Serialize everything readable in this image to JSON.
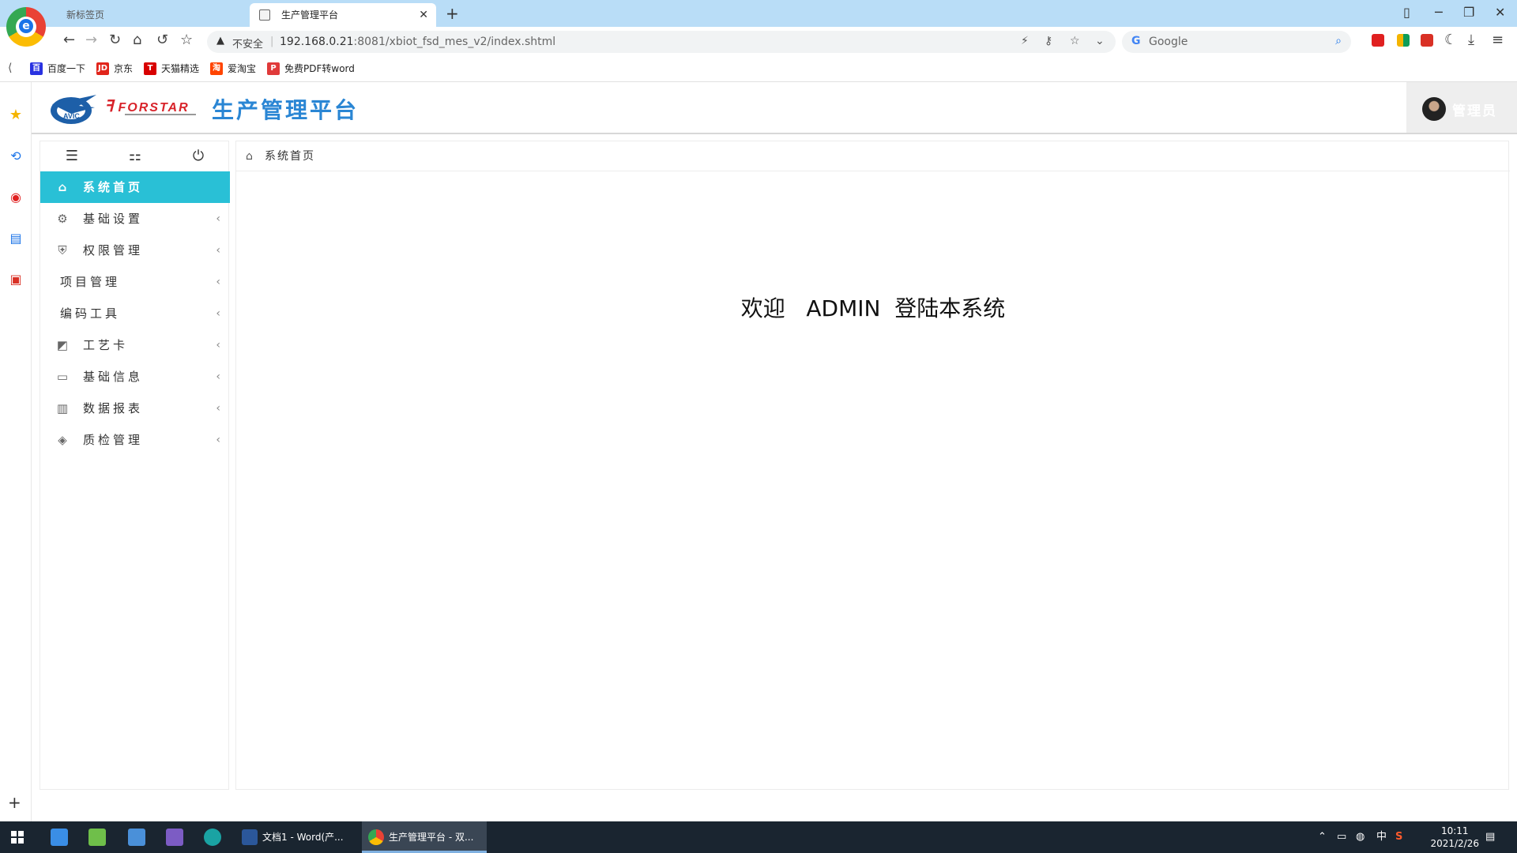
{
  "browser": {
    "tabs": [
      {
        "title": "新标签页",
        "active": false
      },
      {
        "title": "生产管理平台",
        "active": true
      }
    ],
    "address": {
      "security_label": "不安全",
      "url_host": "192.168.0.21",
      "url_rest": ":8081/xbiot_fsd_mes_v2/index.shtml"
    },
    "search": {
      "placeholder": "Google"
    },
    "bookmarks": [
      {
        "label": "百度一下",
        "icon": "baidu-icon",
        "color": "#2932e1"
      },
      {
        "label": "京东",
        "icon": "jd-icon",
        "color": "#e1251b"
      },
      {
        "label": "天猫精选",
        "icon": "tmall-icon",
        "color": "#d80000"
      },
      {
        "label": "爱淘宝",
        "icon": "aitaobao-icon",
        "color": "#ff4400"
      },
      {
        "label": "免费PDF转word",
        "icon": "pdf-icon",
        "color": "#e03a3a"
      }
    ]
  },
  "app": {
    "brand": "FORSTAR",
    "logo_text": "AVIC",
    "title": "生产管理平台",
    "user": "管理员",
    "accent_color": "#29c0d6",
    "title_color": "#2a86d4",
    "sidebar_tools": [
      "menu-toggle-icon",
      "book-icon",
      "power-icon"
    ],
    "menu": [
      {
        "label": "系统首页",
        "icon": "home-icon",
        "active": true,
        "arrow": false
      },
      {
        "label": "基础设置",
        "icon": "gear-icon",
        "active": false,
        "arrow": true
      },
      {
        "label": "权限管理",
        "icon": "shield-icon",
        "active": false,
        "arrow": true
      },
      {
        "label": "项目管理",
        "icon": "",
        "active": false,
        "arrow": true
      },
      {
        "label": "编码工具",
        "icon": "",
        "active": false,
        "arrow": true
      },
      {
        "label": "工艺卡",
        "icon": "card-icon",
        "active": false,
        "arrow": true
      },
      {
        "label": "基础信息",
        "icon": "monitor-icon",
        "active": false,
        "arrow": true
      },
      {
        "label": "数据报表",
        "icon": "table-icon",
        "active": false,
        "arrow": true
      },
      {
        "label": "质检管理",
        "icon": "layers-icon",
        "active": false,
        "arrow": true
      }
    ],
    "breadcrumb": "系统首页",
    "welcome": "欢迎   ADMIN  登陆本系统"
  },
  "taskbar": {
    "apps": [
      {
        "label": "文档1 - Word(产...",
        "icon": "word-icon",
        "active": false
      },
      {
        "label": "生产管理平台 - 双...",
        "icon": "browser-icon",
        "active": true
      }
    ],
    "ime": "中",
    "time": "10:11",
    "date": "2021/2/26"
  }
}
